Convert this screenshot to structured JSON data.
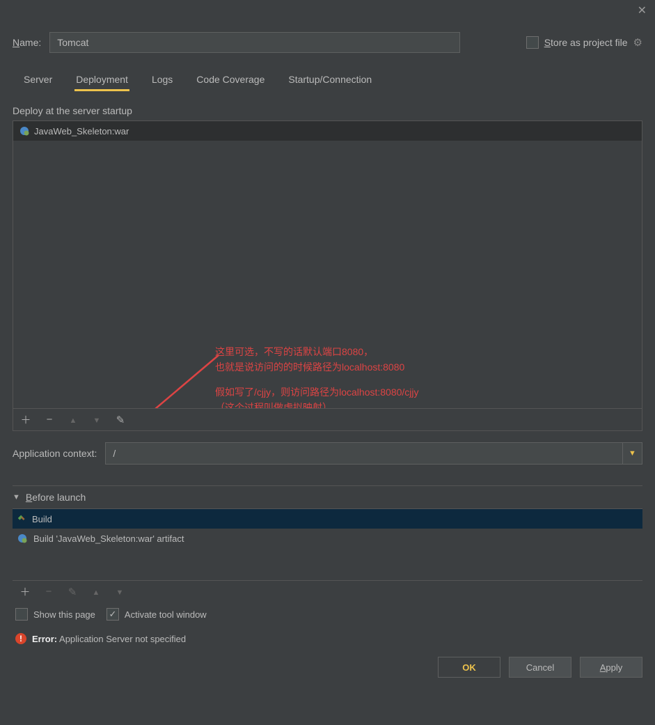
{
  "name_label": "Name:",
  "name_value": "Tomcat",
  "store_label": "Store as project file",
  "tabs": {
    "server": "Server",
    "deployment": "Deployment",
    "logs": "Logs",
    "coverage": "Code Coverage",
    "startup": "Startup/Connection"
  },
  "deploy_label": "Deploy at the server startup",
  "deploy_items": [
    "JavaWeb_Skeleton:war"
  ],
  "annotation_lines": [
    "这里可选，不写的话默认端口8080，",
    "也就是说访问的的时候路径为localhost:8080",
    "",
    "假如写了/cjjy，则访问路径为localhost:8080/cjjy",
    "（这个过程叫做虚拟映射）"
  ],
  "context_label": "Application context:",
  "context_value": "/",
  "before_launch_label": "Before launch",
  "before_launch_items": [
    "Build",
    "Build 'JavaWeb_Skeleton:war' artifact"
  ],
  "show_page_label": "Show this page",
  "activate_label": "Activate tool window",
  "error_prefix": "Error:",
  "error_msg": "Application Server not specified",
  "buttons": {
    "ok": "OK",
    "cancel": "Cancel",
    "apply": "Apply"
  }
}
